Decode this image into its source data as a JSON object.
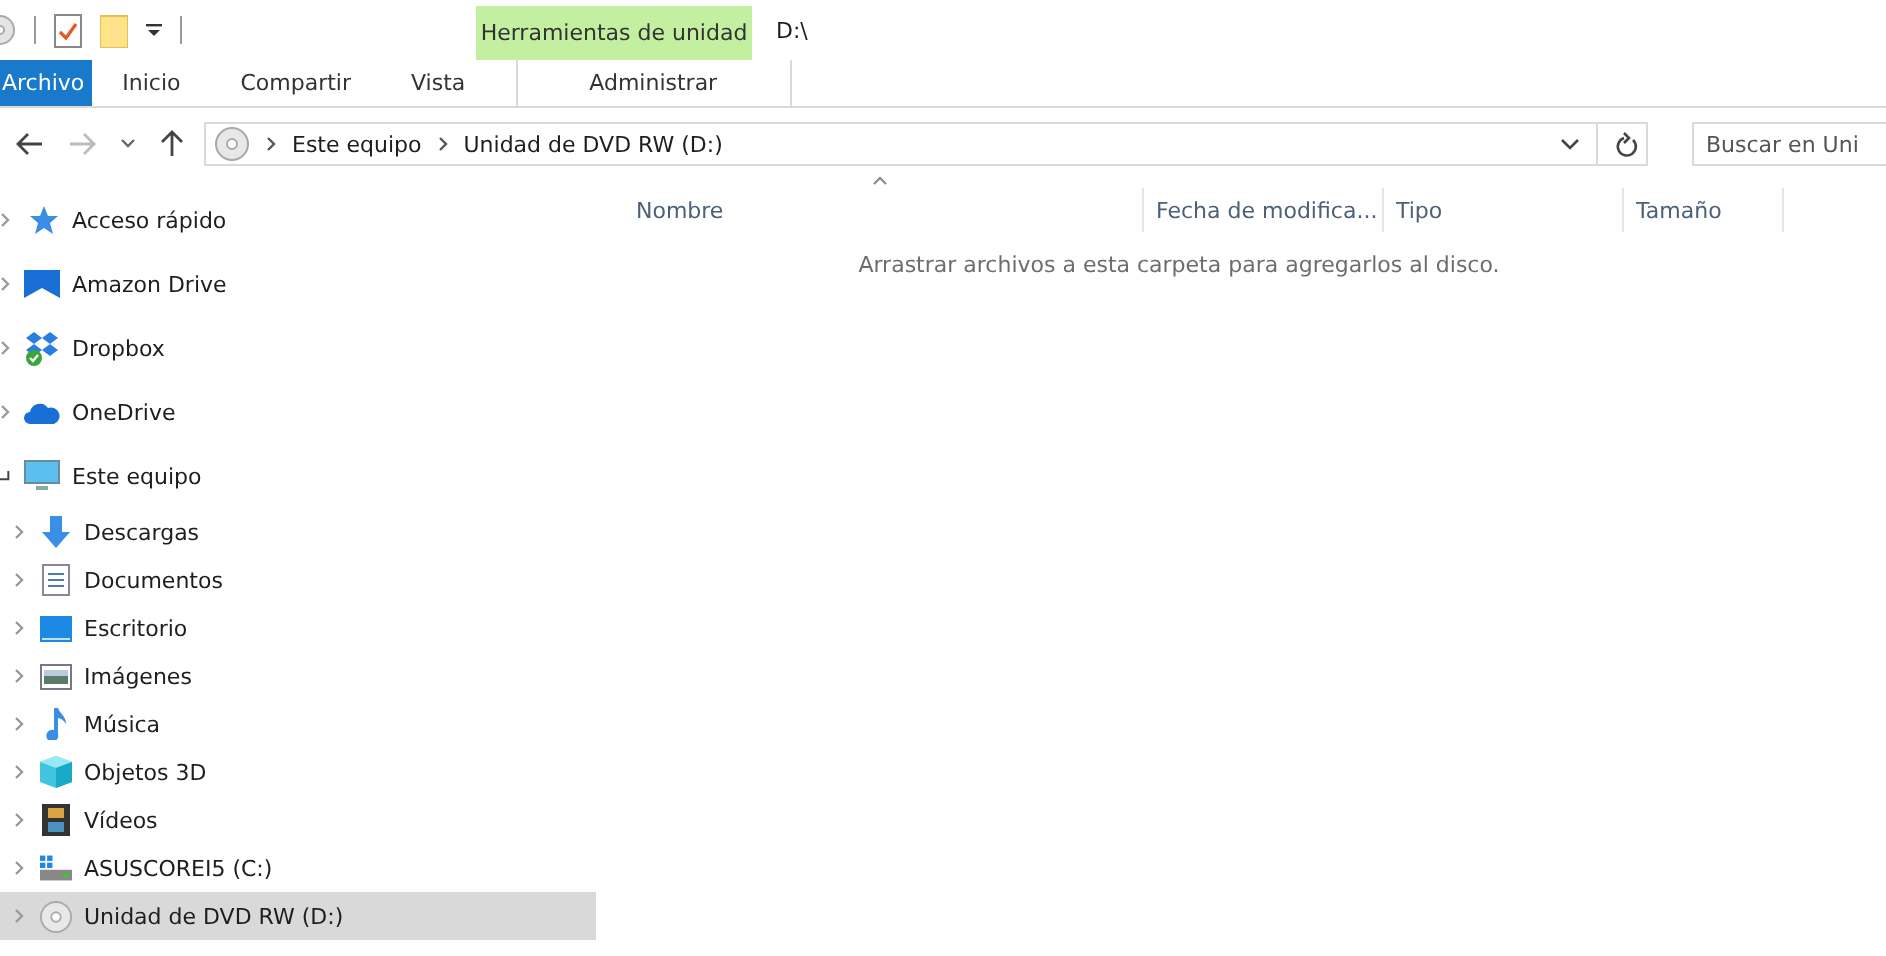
{
  "title_bar": {
    "context_group": "Herramientas de unidad",
    "title": "D:\\"
  },
  "ribbon_tabs": [
    {
      "label": "Archivo",
      "kind": "file"
    },
    {
      "label": "Inicio",
      "kind": "tab"
    },
    {
      "label": "Compartir",
      "kind": "tab"
    },
    {
      "label": "Vista",
      "kind": "tab"
    },
    {
      "label": "Administrar",
      "kind": "context"
    }
  ],
  "address_bar": {
    "crumbs": [
      "Este equipo",
      "Unidad de DVD RW (D:)"
    ]
  },
  "search": {
    "placeholder": "Buscar en Uni"
  },
  "sidebar": {
    "items": [
      {
        "label": "Acceso rápido",
        "expanded": false,
        "selected": false
      },
      {
        "label": "Amazon Drive",
        "expanded": false,
        "selected": false
      },
      {
        "label": "Dropbox",
        "expanded": false,
        "selected": false
      },
      {
        "label": "OneDrive",
        "expanded": false,
        "selected": false
      },
      {
        "label": "Este equipo",
        "expanded": true,
        "selected": false,
        "children": [
          {
            "label": "Descargas",
            "expanded": false,
            "selected": false
          },
          {
            "label": "Documentos",
            "expanded": false,
            "selected": false
          },
          {
            "label": "Escritorio",
            "expanded": false,
            "selected": false
          },
          {
            "label": "Imágenes",
            "expanded": false,
            "selected": false
          },
          {
            "label": "Música",
            "expanded": false,
            "selected": false
          },
          {
            "label": "Objetos 3D",
            "expanded": false,
            "selected": false
          },
          {
            "label": "Vídeos",
            "expanded": false,
            "selected": false
          },
          {
            "label": "ASUSCOREI5 (C:)",
            "expanded": false,
            "selected": false
          },
          {
            "label": "Unidad de DVD RW (D:)",
            "expanded": false,
            "selected": true
          }
        ]
      }
    ]
  },
  "file_list": {
    "columns": [
      "Nombre",
      "Fecha de modifica...",
      "Tipo",
      "Tamaño"
    ],
    "empty_message": "Arrastrar archivos a esta carpeta para agregarlos al disco."
  }
}
